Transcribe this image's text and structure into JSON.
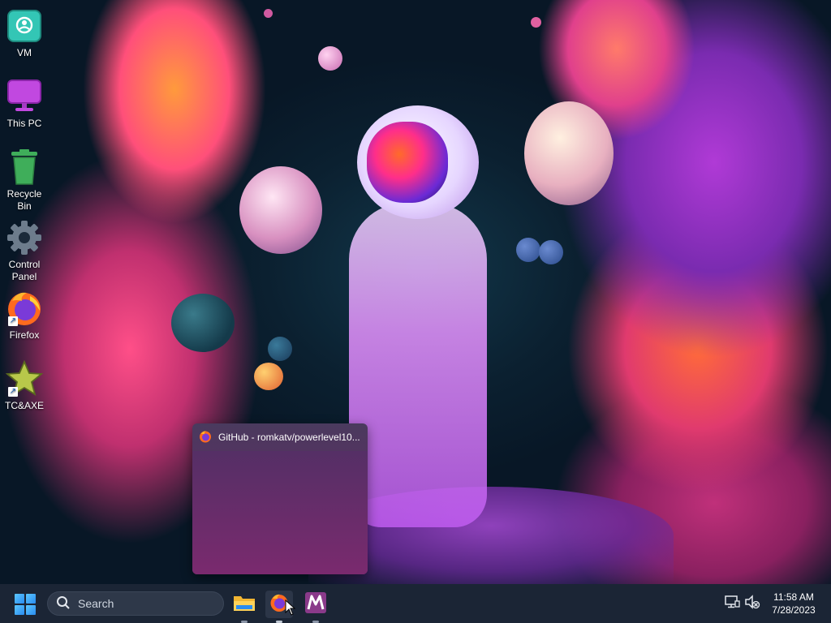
{
  "desktop": {
    "icons": [
      {
        "label": "VM",
        "icon": "vm-folder-icon"
      },
      {
        "label": "This PC",
        "icon": "monitor-icon"
      },
      {
        "label": "Recycle Bin",
        "icon": "recycle-bin-icon"
      },
      {
        "label": "Control Panel",
        "icon": "gear-icon"
      },
      {
        "label": "Firefox",
        "icon": "firefox-icon",
        "shortcut": true
      },
      {
        "label": "TC&AXE",
        "icon": "star-icon",
        "shortcut": true
      }
    ]
  },
  "thumbnail_preview": {
    "title": "GitHub - romkatv/powerlevel10...",
    "icon": "firefox-icon"
  },
  "taskbar": {
    "start_icon": "windows-start-icon",
    "search": {
      "placeholder": "Search"
    },
    "apps": [
      {
        "name": "File Explorer",
        "icon": "folder-icon"
      },
      {
        "name": "Firefox",
        "icon": "firefox-icon",
        "active": true
      },
      {
        "name": "Terminal app",
        "icon": "m-app-icon"
      }
    ],
    "tray": {
      "network_icon": "network-monitor-icon",
      "volume_icon": "speaker-muted-icon"
    },
    "clock": {
      "time": "11:58 AM",
      "date": "7/28/2023"
    }
  },
  "colors": {
    "taskbar_bg": "#1b2535",
    "accent": "#2a8cf0",
    "vm_icon": "#2fb7a8",
    "thispc_icon": "#b43ad6",
    "recycle_icon": "#3fae5a"
  }
}
